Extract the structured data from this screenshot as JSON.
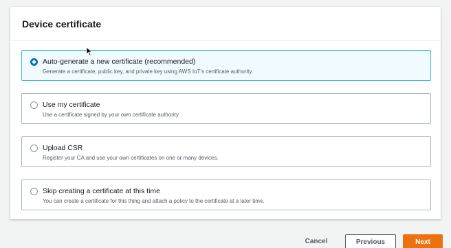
{
  "panel": {
    "title": "Device certificate"
  },
  "options": [
    {
      "label": "Auto-generate a new certificate (recommended)",
      "description": "Generate a certificate, public key, and private key using AWS IoT's certificate authority.",
      "selected": true
    },
    {
      "label": "Use my certificate",
      "description": "Use a certificate signed by your own certificate authority.",
      "selected": false
    },
    {
      "label": "Upload CSR",
      "description": "Register your CA and use your own certificates on one or many devices.",
      "selected": false
    },
    {
      "label": "Skip creating a certificate at this time",
      "description": "You can create a certificate for this thing and attach a policy to the certificate at a later time.",
      "selected": false
    }
  ],
  "footer": {
    "cancel_label": "Cancel",
    "previous_label": "Previous",
    "next_label": "Next"
  },
  "colors": {
    "selected_border": "#44b9d6",
    "radio_selected": "#0073bb",
    "primary_button": "#ec7211"
  }
}
